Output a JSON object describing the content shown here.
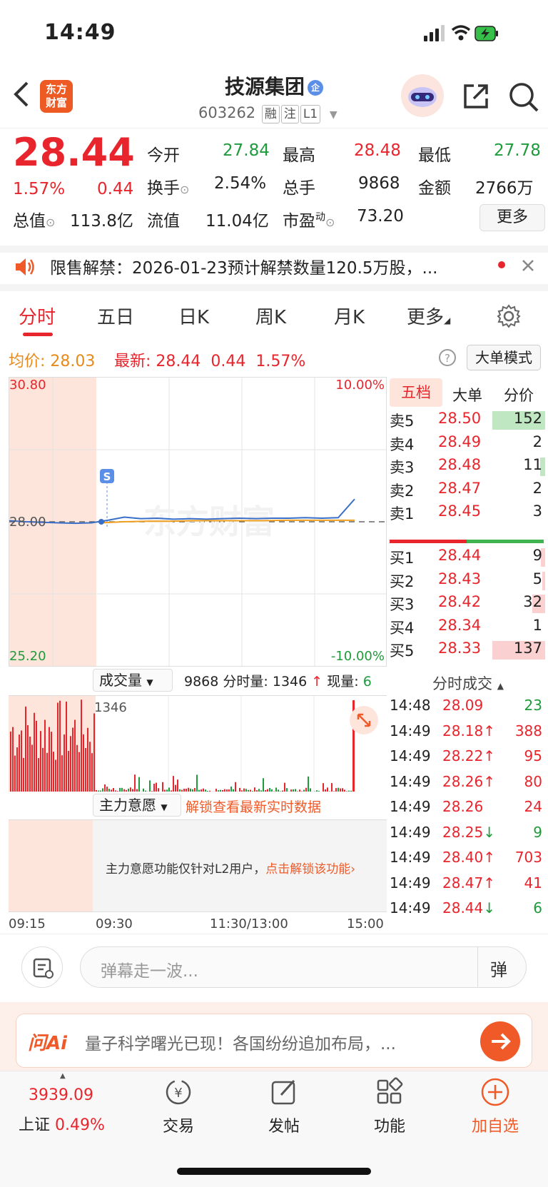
{
  "status": {
    "time": "14:49"
  },
  "header": {
    "logo_line1": "东方",
    "logo_line2": "财富",
    "name": "技源集团",
    "name_badge": "企",
    "code": "603262",
    "tags": [
      "融",
      "注",
      "L1"
    ]
  },
  "quote": {
    "price": "28.44",
    "change_pct": "1.57%",
    "change": "0.44",
    "open_label": "今开",
    "open": "27.84",
    "high_label": "最高",
    "high": "28.48",
    "low_label": "最低",
    "low": "27.78",
    "turnover_label": "换手",
    "turnover": "2.54%",
    "volume_label": "总手",
    "volume": "9868",
    "amount_label": "金额",
    "amount": "2766万",
    "mktcap_label": "总值",
    "mktcap": "113.8亿",
    "float_label": "流值",
    "float": "11.04亿",
    "pe_label": "市盈",
    "pe_sup": "动",
    "pe": "73.20",
    "more_label": "更多"
  },
  "notice": {
    "text": "限售解禁：2026-01-23预计解禁数量120.5万股，..."
  },
  "tabs": [
    "分时",
    "五日",
    "日K",
    "周K",
    "月K",
    "更多"
  ],
  "info": {
    "avg_label": "均价:",
    "avg": "28.03",
    "latest_label": "最新:",
    "latest": "28.44",
    "chg": "0.44",
    "pct": "1.57%",
    "mode_btn": "大单模式"
  },
  "chart": {
    "y_top": "30.80",
    "y_mid": "28.00",
    "y_bottom": "25.20",
    "pct_top": "10.00%",
    "pct_bottom": "-10.00%",
    "watermark": "东方财富",
    "marker": "S",
    "vol_select": "成交量",
    "vol_info_total": "9868",
    "vol_info_label": "分时量:",
    "vol_info_val": "1346",
    "vol_info_now_label": "现量:",
    "vol_info_now": "6",
    "vol_max": "1346",
    "main_select": "主力意愿",
    "main_unlock": "解锁查看最新实时数据",
    "l2_text": "主力意愿功能仅针对L2用户，",
    "l2_link": "点击解锁该功能",
    "times": [
      "09:15",
      "09:30",
      "11:30/13:00",
      "15:00"
    ]
  },
  "chart_data": {
    "type": "line",
    "title": "",
    "ylim": [
      25.2,
      30.8
    ],
    "series": [
      {
        "name": "",
        "values": [
          28.02,
          28.0,
          27.99,
          27.98,
          27.97,
          27.98,
          28.03,
          28.09,
          28.06,
          28.07,
          28.05,
          28.06,
          28.05,
          28.06,
          28.07,
          28.06,
          28.07,
          28.07,
          28.08,
          28.07,
          28.08,
          28.44
        ]
      },
      {
        "name": "均价",
        "values": [
          27.98,
          28.0,
          28.01,
          28.01,
          28.02,
          28.02,
          28.02,
          28.02,
          28.03,
          28.03,
          28.03,
          28.03
        ]
      }
    ]
  },
  "orderbook": {
    "tabs": [
      "五档",
      "大单",
      "分价"
    ],
    "asks": [
      {
        "label": "卖5",
        "price": "28.50",
        "vol": "152",
        "bar": 1.0
      },
      {
        "label": "卖4",
        "price": "28.49",
        "vol": "2",
        "bar": 0
      },
      {
        "label": "卖3",
        "price": "28.48",
        "vol": "11",
        "bar": 0.1
      },
      {
        "label": "卖2",
        "price": "28.47",
        "vol": "2",
        "bar": 0
      },
      {
        "label": "卖1",
        "price": "28.45",
        "vol": "3",
        "bar": 0
      }
    ],
    "bids": [
      {
        "label": "买1",
        "price": "28.44",
        "vol": "9",
        "bar": 0.08
      },
      {
        "label": "买2",
        "price": "28.43",
        "vol": "5",
        "bar": 0.05
      },
      {
        "label": "买3",
        "price": "28.42",
        "vol": "32",
        "bar": 0.25
      },
      {
        "label": "买4",
        "price": "28.34",
        "vol": "1",
        "bar": 0
      },
      {
        "label": "买5",
        "price": "28.33",
        "vol": "137",
        "bar": 1.0
      }
    ],
    "ticks_title": "分时成交",
    "ticks": [
      {
        "t": "14:48",
        "p": "28.09",
        "v": "23",
        "dir": ""
      },
      {
        "t": "14:49",
        "p": "28.18↑",
        "v": "388",
        "dir": "up"
      },
      {
        "t": "14:49",
        "p": "28.22↑",
        "v": "95",
        "dir": "up"
      },
      {
        "t": "14:49",
        "p": "28.26↑",
        "v": "80",
        "dir": "up"
      },
      {
        "t": "14:49",
        "p": "28.26",
        "v": "24",
        "dir": ""
      },
      {
        "t": "14:49",
        "p": "28.25↓",
        "v": "9",
        "dir": "down"
      },
      {
        "t": "14:49",
        "p": "28.40↑",
        "v": "703",
        "dir": "up"
      },
      {
        "t": "14:49",
        "p": "28.47↑",
        "v": "41",
        "dir": "up"
      },
      {
        "t": "14:49",
        "p": "28.44↓",
        "v": "6",
        "dir": "down"
      }
    ]
  },
  "danmaku": {
    "placeholder": "弹幕走一波...",
    "btn": "弹"
  },
  "ai": {
    "logo": "问Ai",
    "text": "量子科学曙光已现！各国纷纷追加布局，..."
  },
  "nav": {
    "index_value": "3939.09",
    "index_name": "上证",
    "index_pct": "0.49%",
    "items": [
      "交易",
      "发帖",
      "功能",
      "加自选"
    ]
  },
  "colors": {
    "up": "#e8252c",
    "down": "#1f9a3c",
    "accent": "#ee5a24"
  }
}
